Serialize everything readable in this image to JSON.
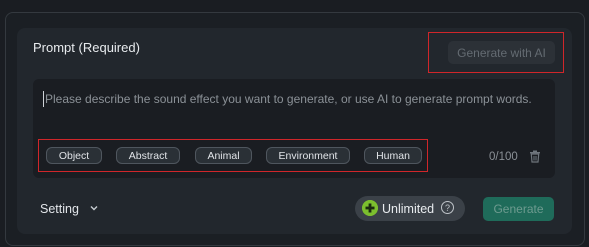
{
  "prompt": {
    "title": "Prompt (Required)",
    "generate_with_ai_label": "Generate with AI",
    "placeholder": "Please describe the sound effect you want to generate, or use AI to generate prompt words.",
    "tags": [
      {
        "label": "Object"
      },
      {
        "label": "Abstract"
      },
      {
        "label": "Animal"
      },
      {
        "label": "Environment"
      },
      {
        "label": "Human"
      }
    ],
    "counter": "0/100",
    "trash_icon": "trash-icon"
  },
  "footer": {
    "setting_label": "Setting",
    "chevron_icon": "chevron-down-icon",
    "unlimited_label": "Unlimited",
    "unlimited_icon": "plus-circle-icon",
    "help_icon": "question-circle-icon",
    "generate_label": "Generate"
  },
  "colors": {
    "accent_green": "#7cbf2e",
    "generate_button": "#1f6b5a",
    "highlight_box": "#d0262a"
  }
}
